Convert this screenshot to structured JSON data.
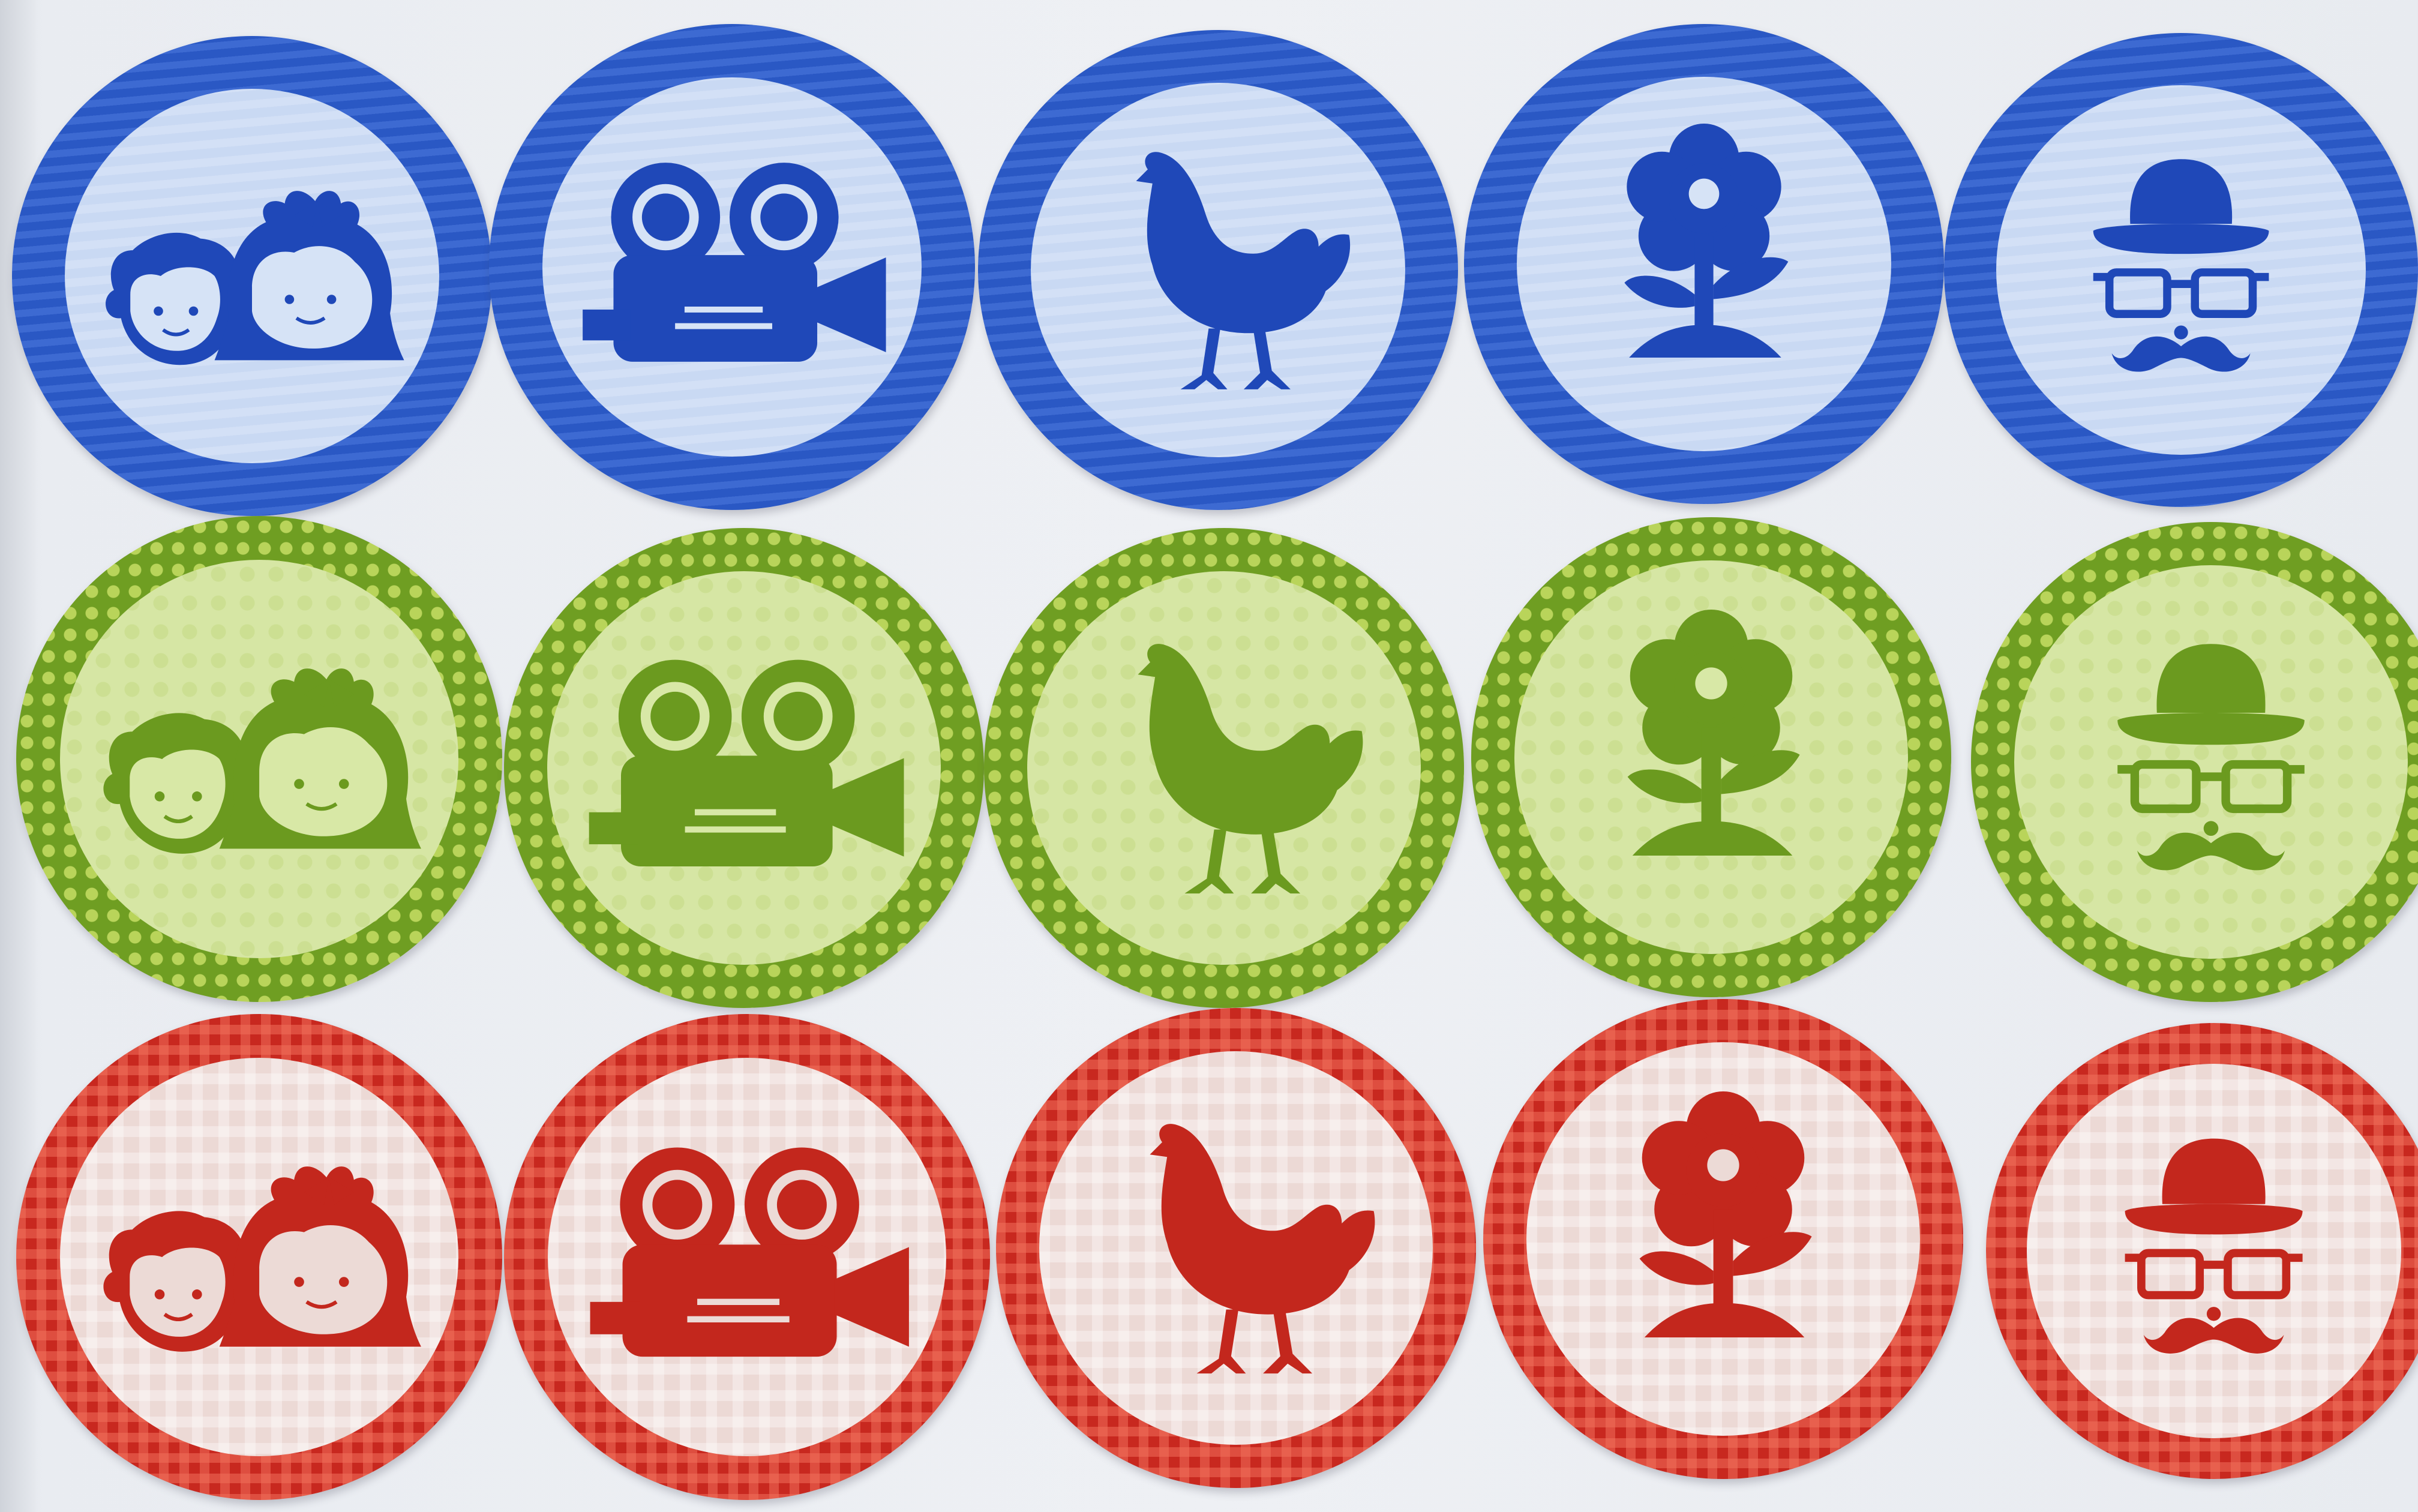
{
  "scene": {
    "description_colors": {
      "blue": "#1f48b8",
      "green": "#6b9a1f",
      "red": "#c3271d"
    },
    "rows": [
      {
        "color": "blue",
        "icons": [
          "children-icon",
          "movie-camera-icon",
          "chicken-icon",
          "flower-icon",
          "gentleman-icon"
        ]
      },
      {
        "color": "green",
        "icons": [
          "children-icon",
          "movie-camera-icon",
          "chicken-icon",
          "flower-icon",
          "gentleman-icon"
        ]
      },
      {
        "color": "red",
        "icons": [
          "children-icon",
          "movie-camera-icon",
          "chicken-icon",
          "flower-icon",
          "gentleman-icon"
        ]
      }
    ]
  }
}
